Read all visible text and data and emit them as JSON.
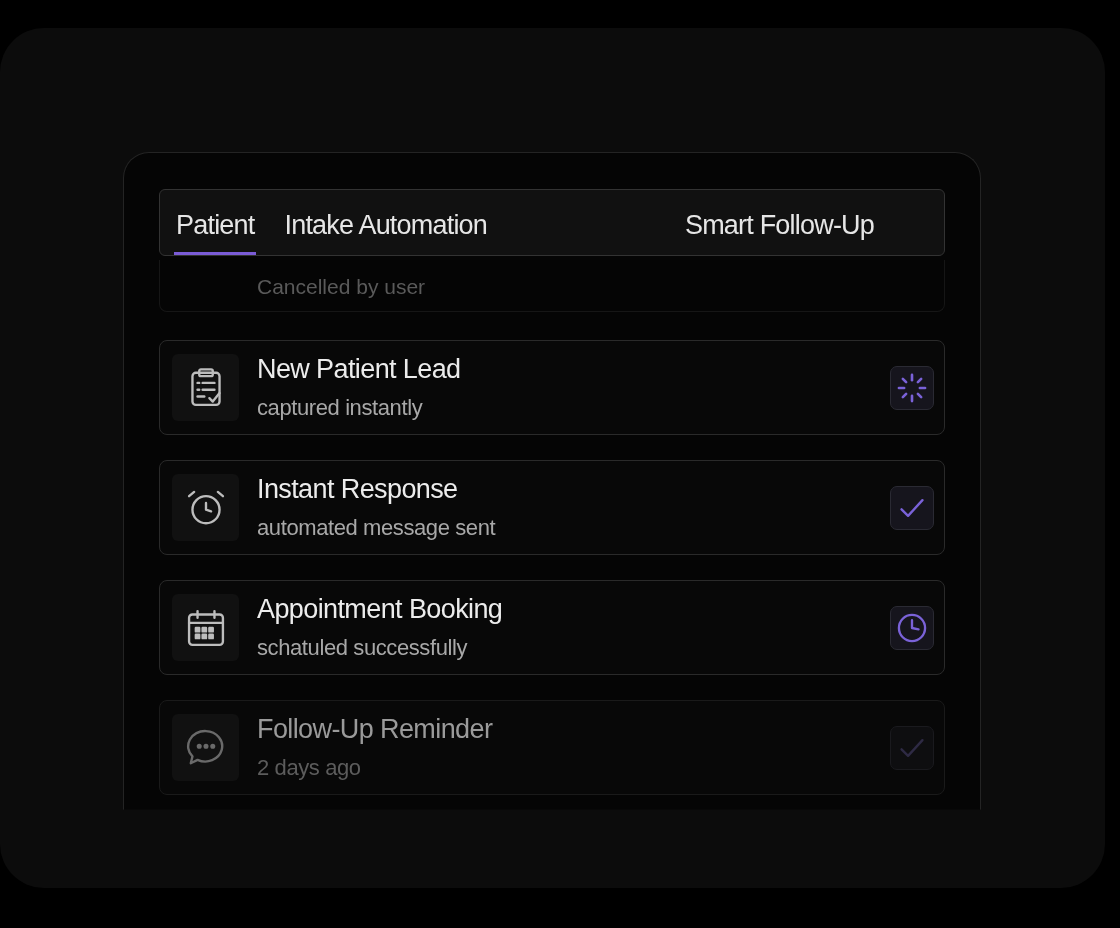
{
  "tabs": [
    {
      "label": "Patient",
      "selected": true
    },
    {
      "label": "Intake Automation",
      "selected": false
    },
    {
      "label": "Smart Follow-Up",
      "selected": false
    }
  ],
  "clipped_item": {
    "subtitle": "Cancelled by user"
  },
  "steps": [
    {
      "title": "New Patient Lead",
      "subtitle": "captured instantly",
      "kind": "loading",
      "faded": false
    },
    {
      "title": "Instant Response",
      "subtitle": "automated message sent",
      "kind": "done",
      "faded": false
    },
    {
      "title": "Appointment Booking",
      "subtitle": "schatuled successfully",
      "kind": "pending",
      "faded": false
    },
    {
      "title": "Follow-Up Reminder",
      "subtitle": "2 days ago",
      "kind": "done",
      "faded": true
    }
  ]
}
